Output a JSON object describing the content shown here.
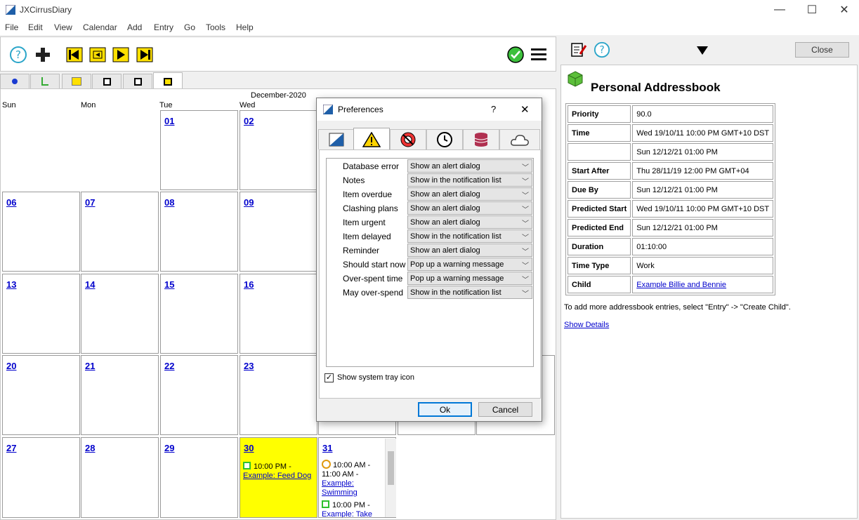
{
  "window": {
    "title": "JXCirrusDiary",
    "minimize": "—",
    "maximize": "☐",
    "close": "✕"
  },
  "menu": [
    "File",
    "Edit",
    "View",
    "Calendar",
    "Add",
    "Entry",
    "Go",
    "Tools",
    "Help"
  ],
  "icons": {
    "help": "help-icon",
    "add": "plus-icon",
    "nav": [
      "first-icon",
      "prev-icon",
      "next-icon",
      "last-icon"
    ],
    "status": "status-ok-icon",
    "menu": "hamburger-menu-icon"
  },
  "calendar": {
    "month_label": "December-2020",
    "weekdays": [
      "Sun",
      "Mon",
      "Tue",
      "Wed"
    ],
    "rows": [
      [
        "",
        "",
        "01",
        "02"
      ],
      [
        "06",
        "07",
        "08",
        "09"
      ],
      [
        "13",
        "14",
        "15",
        "16"
      ],
      [
        "20",
        "21",
        "22",
        "23"
      ],
      [
        "27",
        "28",
        "29",
        "30",
        "31"
      ]
    ],
    "events": {
      "d30": {
        "time": "10:00 PM -",
        "link": "Example: Feed Dog"
      },
      "d31a": {
        "time": "10:00 AM -",
        "time2": "11:00 AM -",
        "link": "Example:",
        "link2": "Swimming"
      },
      "d31b": {
        "time": "10:00 PM -",
        "link": "Example: Take"
      }
    },
    "highlight_color": "#ffff00"
  },
  "right": {
    "close_label": "Close",
    "heading": "Personal Addressbook",
    "props": [
      {
        "k": "Priority",
        "v": "90.0"
      },
      {
        "k": "Time",
        "v": "Wed 19/10/11 10:00 PM GMT+10 DST"
      },
      {
        "k": "",
        "v": "Sun 12/12/21 01:00 PM"
      },
      {
        "k": "Start After",
        "v": "Thu 28/11/19 12:00 PM GMT+04"
      },
      {
        "k": "Due By",
        "v": "Sun 12/12/21 01:00 PM"
      },
      {
        "k": "Predicted Start",
        "v": "Wed 19/10/11 10:00 PM GMT+10 DST"
      },
      {
        "k": "Predicted End",
        "v": "Sun 12/12/21 01:00 PM"
      },
      {
        "k": "Duration",
        "v": "01:10:00"
      },
      {
        "k": "Time Type",
        "v": "Work"
      },
      {
        "k": "Child",
        "v": "Example Billie and Bennie",
        "link": true
      }
    ],
    "note": "To add more addressbook entries, select \"Entry\" -> \"Create Child\".",
    "show_details": "Show Details"
  },
  "dialog": {
    "title": "Preferences",
    "help": "?",
    "close": "✕",
    "rows": [
      {
        "label": "Database error",
        "value": "Show an alert dialog"
      },
      {
        "label": "Notes",
        "value": "Show in the notification list"
      },
      {
        "label": "Item overdue",
        "value": "Show an alert dialog"
      },
      {
        "label": "Clashing plans",
        "value": "Show an alert dialog"
      },
      {
        "label": "Item urgent",
        "value": "Show an alert dialog"
      },
      {
        "label": "Item delayed",
        "value": "Show in the notification list"
      },
      {
        "label": "Reminder",
        "value": "Show an alert dialog"
      },
      {
        "label": "Should start now",
        "value": "Pop up a warning message"
      },
      {
        "label": "Over-spent time",
        "value": "Pop up a warning message"
      },
      {
        "label": "May over-spend",
        "value": "Show in the notification list"
      }
    ],
    "tray_label": "Show system tray icon",
    "tray_checked": "✓",
    "ok": "Ok",
    "cancel": "Cancel"
  }
}
